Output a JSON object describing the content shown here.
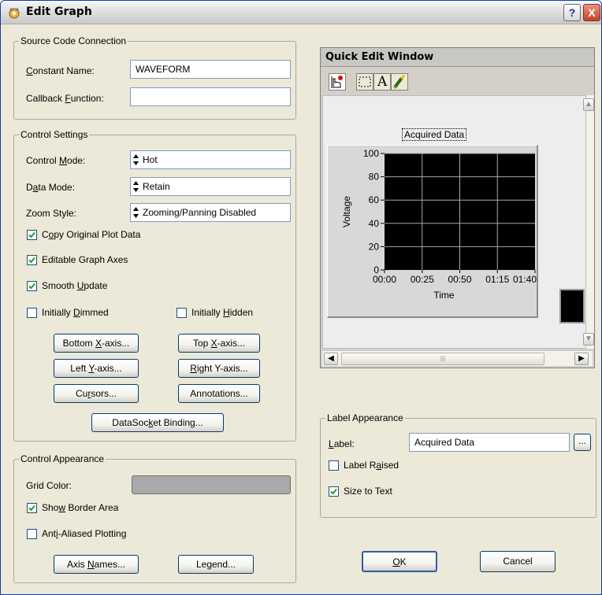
{
  "window": {
    "title": "Edit Graph",
    "help_label": "?",
    "close_label": "X"
  },
  "source_code": {
    "title": "Source Code Connection",
    "constant_name_label": "Constant Name:",
    "constant_name_value": "WAVEFORM",
    "callback_label": "Callback Function:",
    "callback_value": ""
  },
  "control_settings": {
    "title": "Control Settings",
    "control_mode_label": "Control Mode:",
    "control_mode_value": "Hot",
    "data_mode_label": "Data Mode:",
    "data_mode_value": "Retain",
    "zoom_style_label": "Zoom Style:",
    "zoom_style_value": "Zooming/Panning Disabled",
    "copy_original": {
      "label": "Copy Original Plot Data",
      "checked": true
    },
    "editable_axes": {
      "label": "Editable Graph Axes",
      "checked": true
    },
    "smooth_update": {
      "label": "Smooth Update",
      "checked": true
    },
    "initially_dimmed": {
      "label": "Initially Dimmed",
      "checked": false
    },
    "initially_hidden": {
      "label": "Initially Hidden",
      "checked": false
    },
    "buttons": {
      "bottom_x": "Bottom X-axis...",
      "top_x": "Top X-axis...",
      "left_y": "Left Y-axis...",
      "right_y": "Right Y-axis...",
      "cursors": "Cursors...",
      "annotations": "Annotations...",
      "datasocket": "DataSocket Binding..."
    }
  },
  "control_appearance": {
    "title": "Control Appearance",
    "grid_color_label": "Grid Color:",
    "grid_color": "#a9a9a9",
    "show_border": {
      "label": "Show Border Area",
      "checked": true
    },
    "anti_aliased": {
      "label": "Anti-Aliased Plotting",
      "checked": false
    },
    "axis_names_button": "Axis Names...",
    "legend_button": "Legend..."
  },
  "quick_edit": {
    "title": "Quick Edit Window",
    "tools": [
      "operate-tool-icon",
      "select-tool-icon",
      "text-tool-icon",
      "color-tool-icon"
    ],
    "text_tool_glyph": "A",
    "graph_label": "Acquired Data",
    "plot_background": "#000000",
    "grid_color": "#a9a9a9"
  },
  "chart_data": {
    "type": "line",
    "title": "Acquired Data",
    "xlabel": "Time",
    "ylabel": "Voltage",
    "x_ticks": [
      "00:00",
      "00:25",
      "00:50",
      "01:15",
      "01:40"
    ],
    "y_ticks": [
      "0",
      "20",
      "40",
      "60",
      "80",
      "100"
    ],
    "ylim": [
      0,
      100
    ],
    "grid": true,
    "series": []
  },
  "label_appearance": {
    "title": "Label Appearance",
    "label_label": "Label:",
    "label_value": "Acquired Data",
    "browse_label": "...",
    "label_raised": {
      "label": "Label Raised",
      "checked": false
    },
    "size_to_text": {
      "label": "Size to Text",
      "checked": true
    }
  },
  "dialog_buttons": {
    "ok": "OK",
    "cancel": "Cancel"
  }
}
